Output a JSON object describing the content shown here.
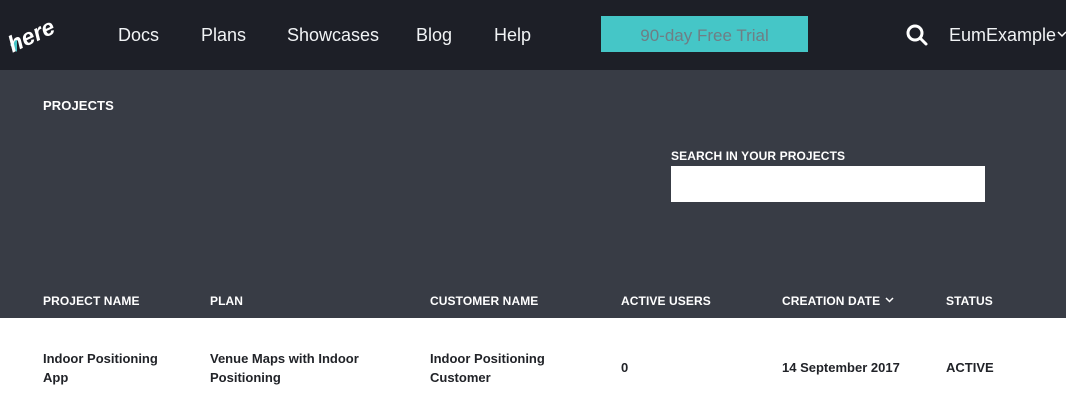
{
  "brand": {
    "logo_text": "here"
  },
  "nav": {
    "items": [
      {
        "label": "Docs"
      },
      {
        "label": "Plans"
      },
      {
        "label": "Showcases"
      },
      {
        "label": "Blog"
      },
      {
        "label": "Help"
      }
    ],
    "trial_button": "90-day Free Trial",
    "user_name": "EumExample"
  },
  "projects": {
    "title": "PROJECTS",
    "search_label": "SEARCH IN YOUR PROJECTS",
    "search_value": "",
    "search_placeholder": ""
  },
  "table": {
    "columns": [
      {
        "label": "PROJECT NAME",
        "sortable": false
      },
      {
        "label": "PLAN",
        "sortable": false
      },
      {
        "label": "CUSTOMER NAME",
        "sortable": false
      },
      {
        "label": "ACTIVE USERS",
        "sortable": false
      },
      {
        "label": "CREATION DATE",
        "sortable": true
      },
      {
        "label": "STATUS",
        "sortable": false
      }
    ],
    "rows": [
      {
        "project_name": "Indoor Positioning App",
        "plan": "Venue Maps with Indoor Positioning",
        "customer_name": "Indoor Positioning Customer",
        "active_users": "0",
        "creation_date": "14 September 2017",
        "status": "ACTIVE"
      }
    ]
  },
  "colors": {
    "nav_background": "#1d1f27",
    "header_background": "#383c45",
    "accent": "#45c6c7"
  },
  "icons": {
    "search": "search-icon",
    "user_menu": "chevron-down-icon",
    "sort": "chevron-down-icon"
  }
}
